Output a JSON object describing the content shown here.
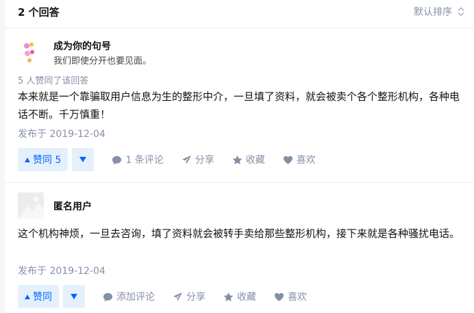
{
  "header": {
    "answer_count": "2 个回答",
    "sort_label": "默认排序"
  },
  "answers": [
    {
      "author_name": "成为你的句号",
      "author_bio": "我们即使分开也要见面。",
      "voters_text": "5 人赞同了该回答",
      "content": "本来就是一个靠骗取用户信息为生的整形中介，一旦填了资料，就会被卖个各个整形机构，各种电话不断。千万慎重！",
      "date": "发布于 2019-12-04",
      "vote_label": "赞同 5",
      "comment_label": "1 条评论",
      "share_label": "分享",
      "collect_label": "收藏",
      "like_label": "喜欢"
    },
    {
      "author_name": "匿名用户",
      "author_bio": "",
      "voters_text": "",
      "content": "这个机构神烦，一旦去咨询，填了资料就会被转手卖给那些整形机构，接下来就是各种骚扰电话。",
      "date": "发布于 2019-12-04",
      "vote_label": "赞同",
      "comment_label": "添加评论",
      "share_label": "分享",
      "collect_label": "收藏",
      "like_label": "喜欢"
    }
  ],
  "colors": {
    "accent": "#0066ff",
    "accent_bg": "#e5f0fd",
    "muted": "#8590a6"
  }
}
